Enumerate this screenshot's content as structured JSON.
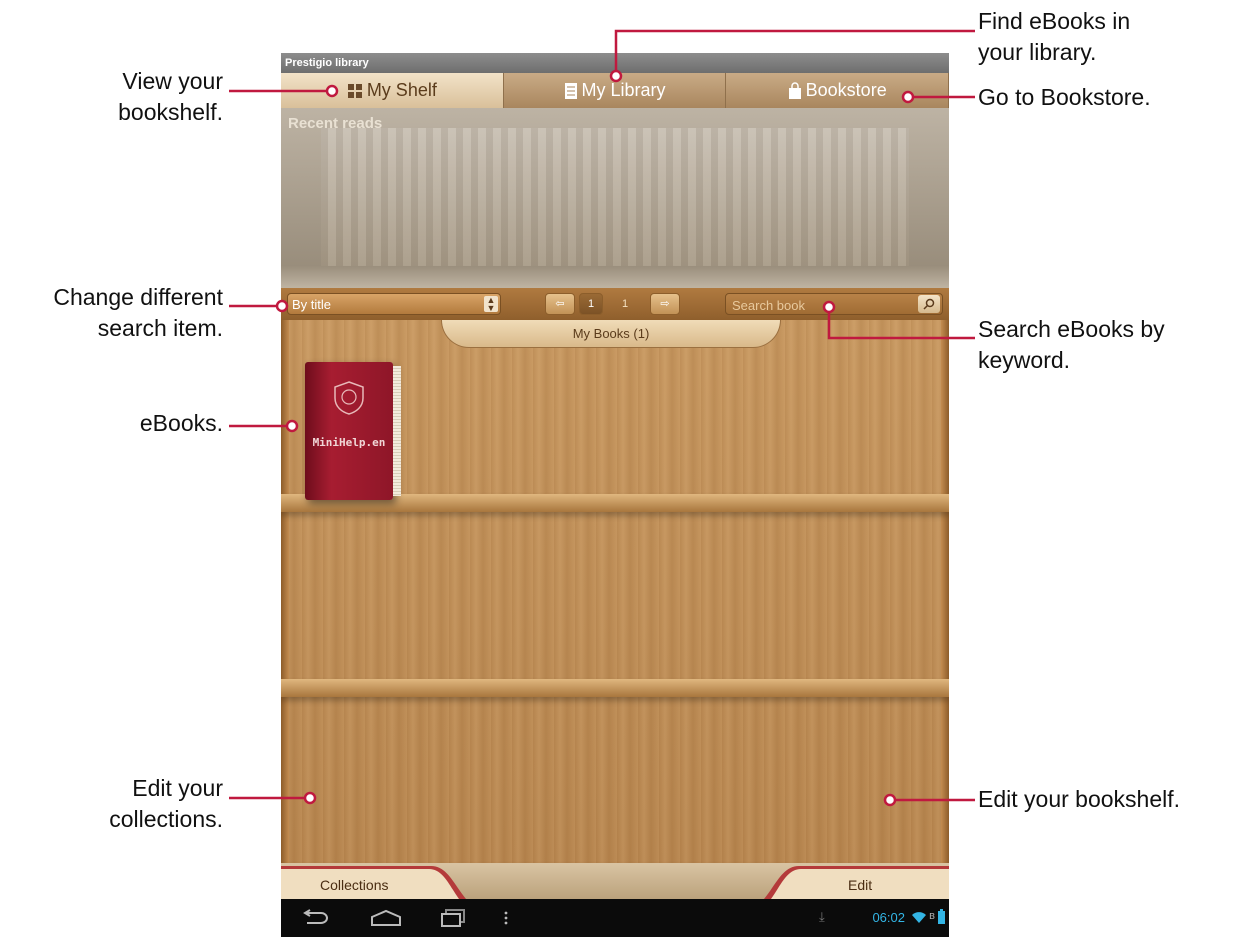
{
  "app": {
    "title": "Prestigio library"
  },
  "tabs": [
    {
      "label": "My Shelf",
      "icon": "grid-icon",
      "active": true
    },
    {
      "label": "My Library",
      "icon": "list-icon",
      "active": false
    },
    {
      "label": "Bookstore",
      "icon": "bag-icon",
      "active": false
    }
  ],
  "recent": {
    "label": "Recent reads"
  },
  "filter": {
    "sort_value": "By title",
    "page_current": "1",
    "page_total": "1",
    "search_placeholder": "Search book"
  },
  "shelf": {
    "header": "My Books (1)",
    "books": [
      {
        "title": "MiniHelp.en"
      }
    ]
  },
  "bottom": {
    "collections_label": "Collections",
    "edit_label": "Edit"
  },
  "status": {
    "time": "06:02"
  },
  "annotations": {
    "view_shelf": [
      "View your",
      "bookshelf."
    ],
    "find_library": [
      "Find eBooks in",
      "your library."
    ],
    "bookstore": "Go to Bookstore.",
    "change_search": [
      "Change different",
      "search item."
    ],
    "search_keyword": [
      "Search eBooks by",
      "keyword."
    ],
    "ebooks": "eBooks.",
    "edit_collections": [
      "Edit your",
      "collections."
    ],
    "edit_shelf": "Edit your bookshelf."
  },
  "colors": {
    "annotation_line": "#c0193f",
    "accent_blue": "#33b5e5"
  }
}
